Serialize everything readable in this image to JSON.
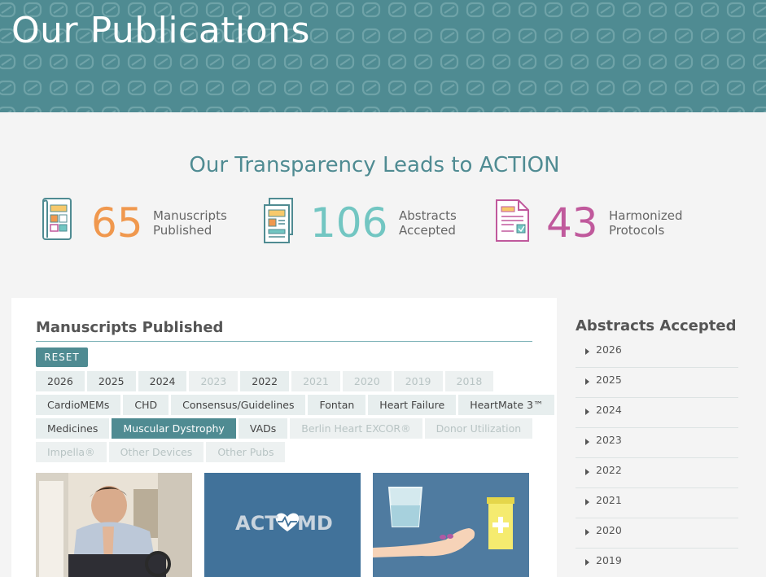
{
  "header": {
    "title": "Our Publications"
  },
  "stats": {
    "title": "Our Transparency Leads to ACTION",
    "items": [
      {
        "value": "65",
        "label_line1": "Manuscripts",
        "label_line2": "Published",
        "color": "#f0984e",
        "icon": "scroll-document-icon"
      },
      {
        "value": "106",
        "label_line1": "Abstracts",
        "label_line2": "Accepted",
        "color": "#72c6c2",
        "icon": "stacked-documents-icon"
      },
      {
        "value": "43",
        "label_line1": "Harmonized",
        "label_line2": "Protocols",
        "color": "#c0599c",
        "icon": "checklist-document-icon"
      }
    ]
  },
  "manuscripts": {
    "title": "Manuscripts Published",
    "reset_label": "RESET",
    "years": [
      "2026",
      "2025",
      "2024",
      "2023",
      "2022",
      "2021",
      "2020",
      "2019",
      "2018"
    ],
    "topics_row1": [
      "CardioMEMs",
      "CHD",
      "Consensus/Guidelines",
      "Fontan",
      "Heart Failure",
      "HeartMate 3™"
    ],
    "topics_row2": [
      "Medicines",
      "Muscular Dystrophy",
      "VADs",
      "Berlin Heart EXCOR®",
      "Donor Utilization"
    ],
    "topics_row3": [
      "Impella®",
      "Other Devices",
      "Other Pubs"
    ],
    "active_topic": "Muscular Dystrophy",
    "thumbnail_logo": {
      "prefix": "ACT",
      "suffix": "MD"
    }
  },
  "abstracts": {
    "title": "Abstracts Accepted",
    "years": [
      "2026",
      "2025",
      "2024",
      "2023",
      "2022",
      "2021",
      "2020",
      "2019"
    ]
  },
  "colors": {
    "brand_teal": "#4f8b92",
    "orange": "#f0984e",
    "aqua": "#72c6c2",
    "magenta": "#c0599c"
  }
}
